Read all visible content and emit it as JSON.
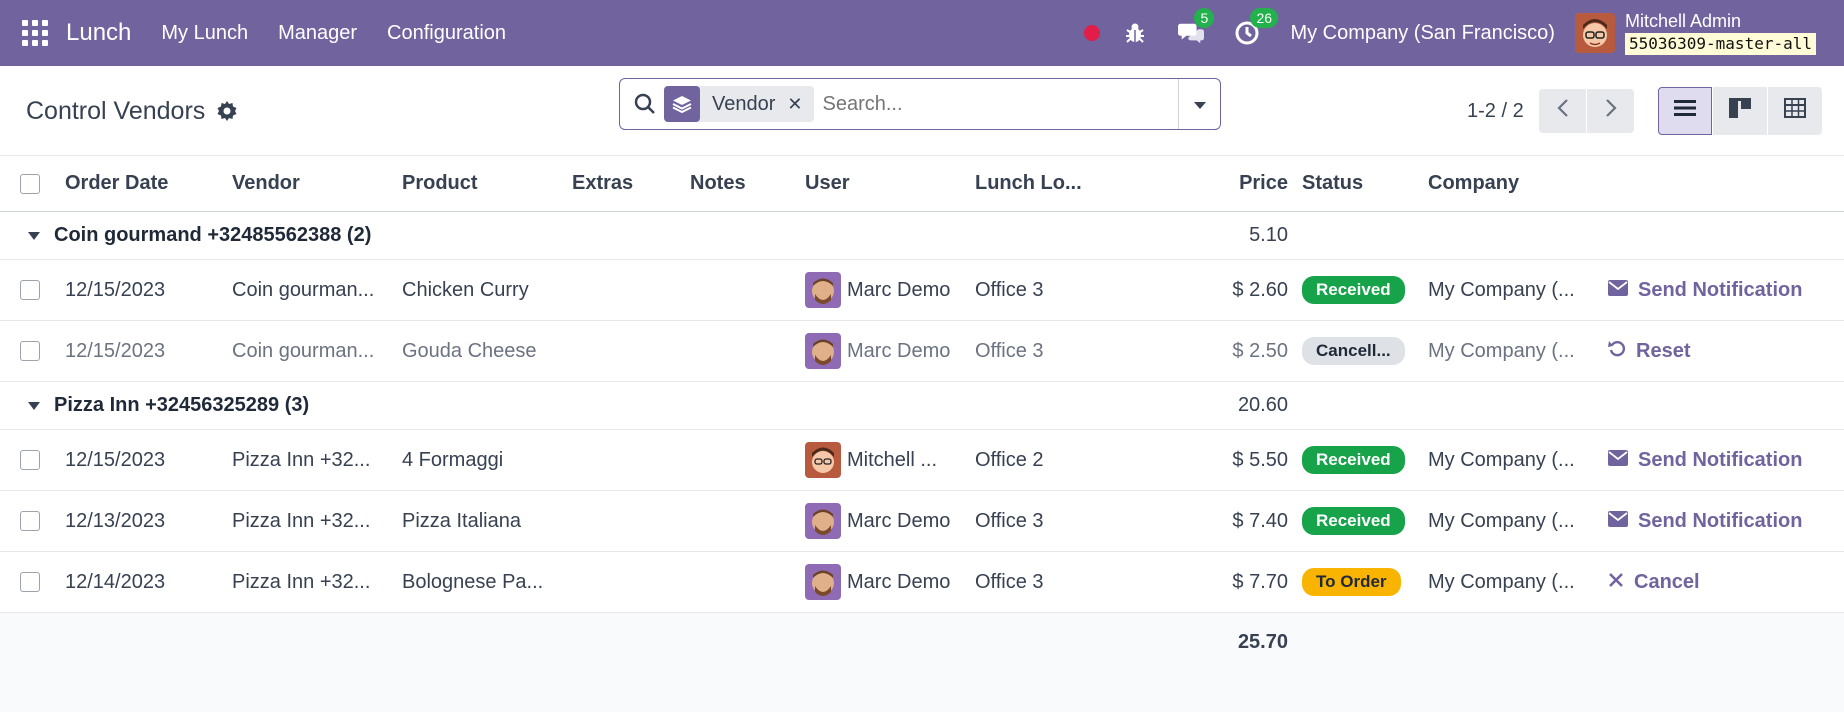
{
  "navbar": {
    "brand": "Lunch",
    "menus": [
      "My Lunch",
      "Manager",
      "Configuration"
    ],
    "messages_count": "5",
    "activities_count": "26",
    "company": "My Company (San Francisco)",
    "user_name": "Mitchell Admin",
    "database": "55036309-master-all"
  },
  "control_panel": {
    "title": "Control Vendors",
    "search_facet": "Vendor",
    "search_placeholder": "Search...",
    "pager": "1-2 / 2"
  },
  "table": {
    "headers": {
      "order_date": "Order Date",
      "vendor": "Vendor",
      "product": "Product",
      "extras": "Extras",
      "notes": "Notes",
      "user": "User",
      "location": "Lunch Lo...",
      "price": "Price",
      "status": "Status",
      "company": "Company"
    },
    "groups": [
      {
        "title": "Coin gourmand +32485562388 (2)",
        "sum": "5.10",
        "rows": [
          {
            "date": "12/15/2023",
            "vendor": "Coin gourman...",
            "product": "Chicken Curry",
            "user": "Marc Demo",
            "location": "Office 3",
            "price": "$ 2.60",
            "status": "Received",
            "company": "My Company (...",
            "action": "Send Notification"
          },
          {
            "date": "12/15/2023",
            "vendor": "Coin gourman...",
            "product": "Gouda Cheese",
            "user": "Marc Demo",
            "location": "Office 3",
            "price": "$ 2.50",
            "status": "Cancell...",
            "company": "My Company (...",
            "action": "Reset"
          }
        ]
      },
      {
        "title": "Pizza Inn +32456325289 (3)",
        "sum": "20.60",
        "rows": [
          {
            "date": "12/15/2023",
            "vendor": "Pizza Inn +32...",
            "product": "4 Formaggi",
            "user": "Mitchell ...",
            "location": "Office 2",
            "price": "$ 5.50",
            "status": "Received",
            "company": "My Company (...",
            "action": "Send Notification"
          },
          {
            "date": "12/13/2023",
            "vendor": "Pizza Inn +32...",
            "product": "Pizza Italiana",
            "user": "Marc Demo",
            "location": "Office 3",
            "price": "$ 7.40",
            "status": "Received",
            "company": "My Company (...",
            "action": "Send Notification"
          },
          {
            "date": "12/14/2023",
            "vendor": "Pizza Inn +32...",
            "product": "Bolognese Pa...",
            "user": "Marc Demo",
            "location": "Office 3",
            "price": "$ 7.70",
            "status": "To Order",
            "company": "My Company (...",
            "action": "Cancel"
          }
        ]
      }
    ],
    "total": "25.70"
  },
  "colors": {
    "brand": "#71639e",
    "received": "#16a34a",
    "to_order": "#f8b400",
    "cancelled": "#dee2e6"
  }
}
